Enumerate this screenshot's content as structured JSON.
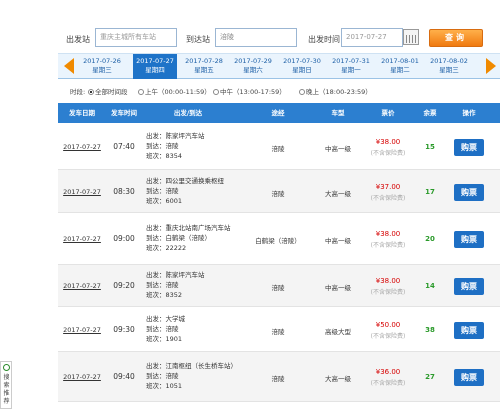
{
  "search": {
    "depart_label": "出发站",
    "depart_placeholder": "重庆主城所有车站",
    "arrive_label": "到达站",
    "arrive_value": "涪陵",
    "time_label": "出发时间",
    "time_value": "2017-07-27",
    "search_button": "查询"
  },
  "dates": [
    {
      "date": "2017-07-26",
      "weekday": "星期三"
    },
    {
      "date": "2017-07-27",
      "weekday": "星期四"
    },
    {
      "date": "2017-07-28",
      "weekday": "星期五"
    },
    {
      "date": "2017-07-29",
      "weekday": "星期六"
    },
    {
      "date": "2017-07-30",
      "weekday": "星期日"
    },
    {
      "date": "2017-07-31",
      "weekday": "星期一"
    },
    {
      "date": "2017-08-01",
      "weekday": "星期二"
    },
    {
      "date": "2017-08-02",
      "weekday": "星期三"
    }
  ],
  "time_filter": {
    "label": "时段:",
    "options": [
      "全部时间段",
      "上午（00:00-11:59）",
      "中午（13:00-17:59）",
      "晚上（18:00-23:59）"
    ],
    "selected": "全部时间段"
  },
  "table": {
    "headers": [
      "发车日期",
      "发车时间",
      "出发/到达",
      "途经",
      "车型",
      "票价",
      "余票",
      "操作"
    ],
    "rows": [
      {
        "date": "2017-07-27",
        "time": "07:40",
        "from": "出发：陈家坪汽车站",
        "to": "到达：涪陵",
        "bus": "班次：8354",
        "via": "涪陵",
        "type": "中高一级",
        "price": "¥38.00",
        "note": "(不含保险费)",
        "left": "15",
        "buy": "购票"
      },
      {
        "date": "2017-07-27",
        "time": "08:30",
        "from": "出发：四公里交通换乘枢纽",
        "to": "到达：涪陵",
        "bus": "班次：6001",
        "via": "涪陵",
        "type": "大高一级",
        "price": "¥37.00",
        "note": "(不含保险费)",
        "left": "17",
        "buy": "购票"
      },
      {
        "date": "2017-07-27",
        "time": "09:00",
        "from": "出发：重庆北站南广场汽车站",
        "to": "到达：白鹤梁（涪陵）",
        "bus": "班次：22222",
        "via": "白鹤梁（涪陵）",
        "type": "中高一级",
        "price": "¥38.00",
        "note": "(不含保险费)",
        "left": "20",
        "buy": "购票"
      },
      {
        "date": "2017-07-27",
        "time": "09:20",
        "from": "出发：陈家坪汽车站",
        "to": "到达：涪陵",
        "bus": "班次：8352",
        "via": "涪陵",
        "type": "中高一级",
        "price": "¥38.00",
        "note": "(不含保险费)",
        "left": "14",
        "buy": "购票"
      },
      {
        "date": "2017-07-27",
        "time": "09:30",
        "from": "出发：大学城",
        "to": "到达：涪陵",
        "bus": "班次：1901",
        "via": "涪陵",
        "type": "高级大型",
        "price": "¥50.00",
        "note": "(不含保险费)",
        "left": "38",
        "buy": "购票"
      },
      {
        "date": "2017-07-27",
        "time": "09:40",
        "from": "出发：江南枢纽（长生桥车站）",
        "to": "到达：涪陵",
        "bus": "班次：1051",
        "via": "涪陵",
        "type": "大高一级",
        "price": "¥36.00",
        "note": "(不含保险费)",
        "left": "27",
        "buy": "购票"
      }
    ]
  },
  "side_widget": {
    "text": "搜索推荐"
  }
}
